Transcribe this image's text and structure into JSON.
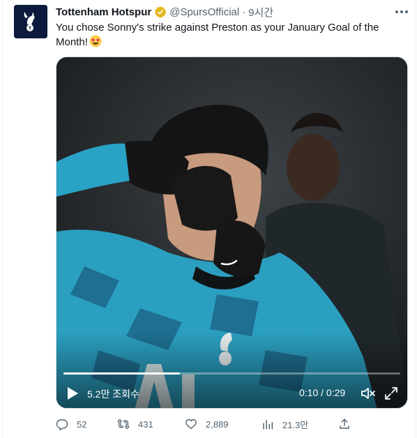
{
  "tweet": {
    "author_name": "Tottenham Hotspur",
    "handle": "@SpursOfficial",
    "separator": "·",
    "time": "9시간",
    "text": "You chose Sonny's strike against Preston as your January Goal of the Month!",
    "emoji": "star-struck-emoji"
  },
  "video": {
    "views_label": "5.2만 조회수",
    "timecode": "0:10 / 0:29",
    "progress": 0.345
  },
  "actions": {
    "replies": "52",
    "retweets": "431",
    "likes": "2,889",
    "views": "21.3만"
  },
  "colors": {
    "club_navy": "#0b1a3d",
    "verified_gold": "#e2b719",
    "text_primary": "#0f1419",
    "text_secondary": "#536471"
  }
}
